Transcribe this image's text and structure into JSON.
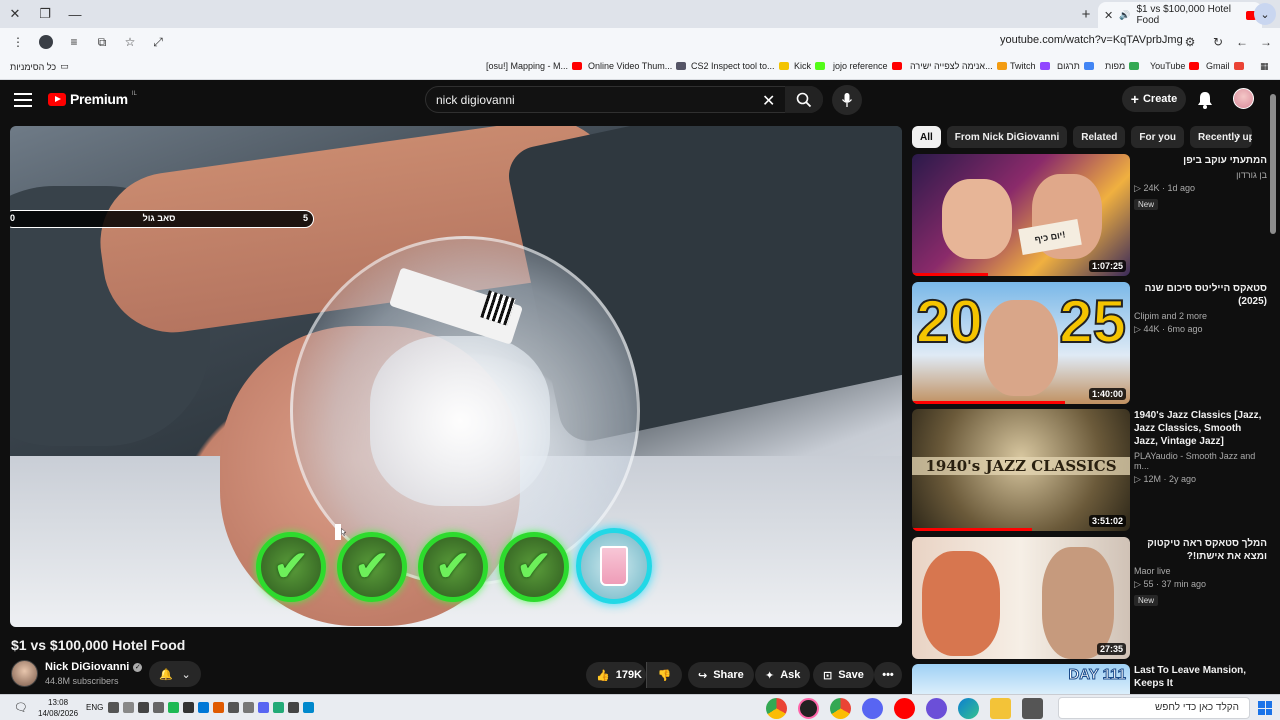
{
  "browser": {
    "tab_title": "$1 vs $100,000 Hotel Food",
    "url": "youtube.com/watch?v=KqTAVprbJmg",
    "bookmarks_all_label": "כל הסימניות",
    "bookmarks": [
      {
        "label": "[osu!] Mapping - M...",
        "color": "#ff0000"
      },
      {
        "label": "Online Video Thum...",
        "color": "#e33"
      },
      {
        "label": "CS2 Inspect tool to...",
        "color": "#555"
      },
      {
        "label": "Kick",
        "color": "#f3a600"
      },
      {
        "label": "jojo reference",
        "color": "#53fc18"
      },
      {
        "label": "אנימה לצפייה ישירה...",
        "color": "#ff0000"
      },
      {
        "label": "Twitch",
        "color": "#ff8c00"
      },
      {
        "label": "תרגום",
        "color": "#9146ff"
      },
      {
        "label": "מפות",
        "color": "#4285f4"
      },
      {
        "label": "YouTube",
        "color": "#34a853"
      },
      {
        "label": "Gmail",
        "color": "#ff0000"
      }
    ]
  },
  "header": {
    "logo_text": "Premium",
    "logo_region": "IL",
    "search_query": "nick digiovanni",
    "create_label": "Create"
  },
  "video": {
    "overlay_left": "0",
    "overlay_center": "סאב גול",
    "overlay_right": "5",
    "title": "$1 vs $100,000 Hotel Food",
    "channel": "Nick DiGiovanni",
    "subscribers": "44.8M subscribers",
    "likes": "179K",
    "share_label": "Share",
    "ask_label": "Ask",
    "save_label": "Save"
  },
  "chips": [
    "All",
    "From Nick DiGiovanni",
    "Related",
    "For you",
    "Recently upl"
  ],
  "recommendations": [
    {
      "title": "המתעתי עוקב ביפן",
      "channel": "בן גורדון",
      "views": "24K",
      "age": "1d ago",
      "badge": "New",
      "duration": "1:07:25",
      "rtl": true
    },
    {
      "title": "סטאקס הייליטס סיכום שנה (2025)",
      "channel": "Clipim and 2 more",
      "views": "44K",
      "age": "6mo ago",
      "badge": "",
      "duration": "1:40:00",
      "rtl": true
    },
    {
      "title": "1940's Jazz Classics [Jazz, Jazz Classics, Smooth Jazz, Vintage Jazz]",
      "channel": "PLAYaudio - Smooth Jazz and m...",
      "views": "12M",
      "age": "2y ago",
      "badge": "",
      "duration": "3:51:02",
      "rtl": false
    },
    {
      "title": "המלך סטאקס ראה טיקטוק ומצא את אישתו!?",
      "channel": "Maor live",
      "views": "55",
      "age": "37 min ago",
      "badge": "New",
      "duration": "27:35",
      "rtl": true
    },
    {
      "title": "Last To Leave Mansion, Keeps It",
      "channel": "",
      "views": "",
      "age": "",
      "badge": "",
      "duration": "",
      "rtl": false
    }
  ],
  "thumbnail_text": {
    "jazz": "1940's JAZZ CLASSICS",
    "year_left": "20",
    "year_right": "25",
    "day": "DAY 111",
    "sign": "יום כיף!"
  },
  "taskbar": {
    "time": "13:08",
    "date": "14/08/2026",
    "lang": "ENG",
    "search_placeholder": "הקלד כאן כדי לחפש"
  },
  "colors": {
    "yt_red": "#ff0000",
    "badge_green": "#2ddb2d",
    "badge_cyan": "#22d8e6"
  }
}
